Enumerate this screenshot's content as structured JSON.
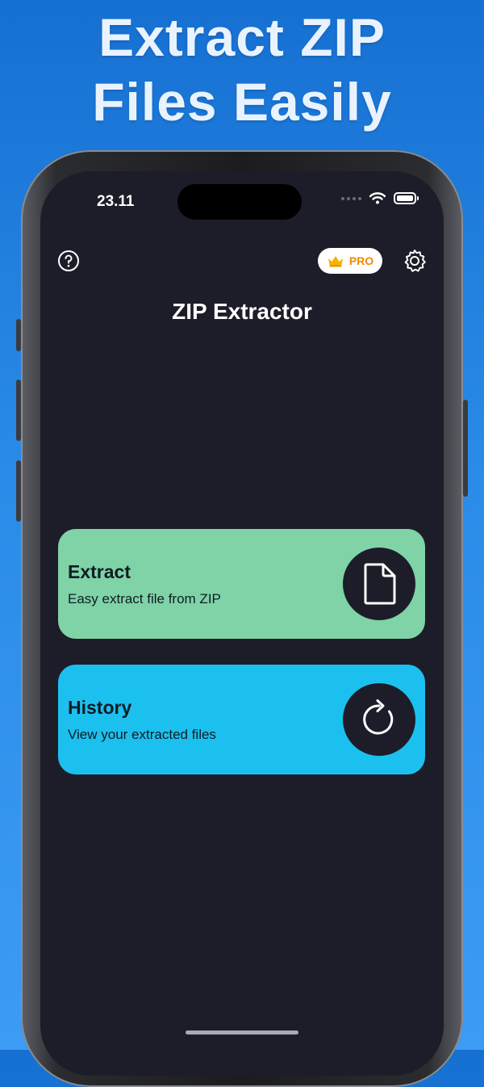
{
  "promo": {
    "headline_line1": "Extract ZIP",
    "headline_line2": "Files Easily"
  },
  "status_bar": {
    "time": "23.11",
    "icons": [
      "signal-dots-icon",
      "wifi-icon",
      "battery-icon"
    ]
  },
  "toolbar": {
    "help_icon": "question-circle-icon",
    "pro_label": "PRO",
    "pro_icon": "crown-icon",
    "settings_icon": "gear-icon"
  },
  "app": {
    "title": "ZIP Extractor"
  },
  "cards": [
    {
      "title": "Extract",
      "subtitle": "Easy extract file from ZIP",
      "icon": "document-icon",
      "color": "#7fd3a7"
    },
    {
      "title": "History",
      "subtitle": "View your extracted files",
      "icon": "refresh-icon",
      "color": "#1cc0ef"
    }
  ],
  "colors": {
    "background_top": "#1670d2",
    "background_bottom": "#3c9cf4",
    "screen": "#1d1d29",
    "pro_accent": "#f08a00"
  }
}
